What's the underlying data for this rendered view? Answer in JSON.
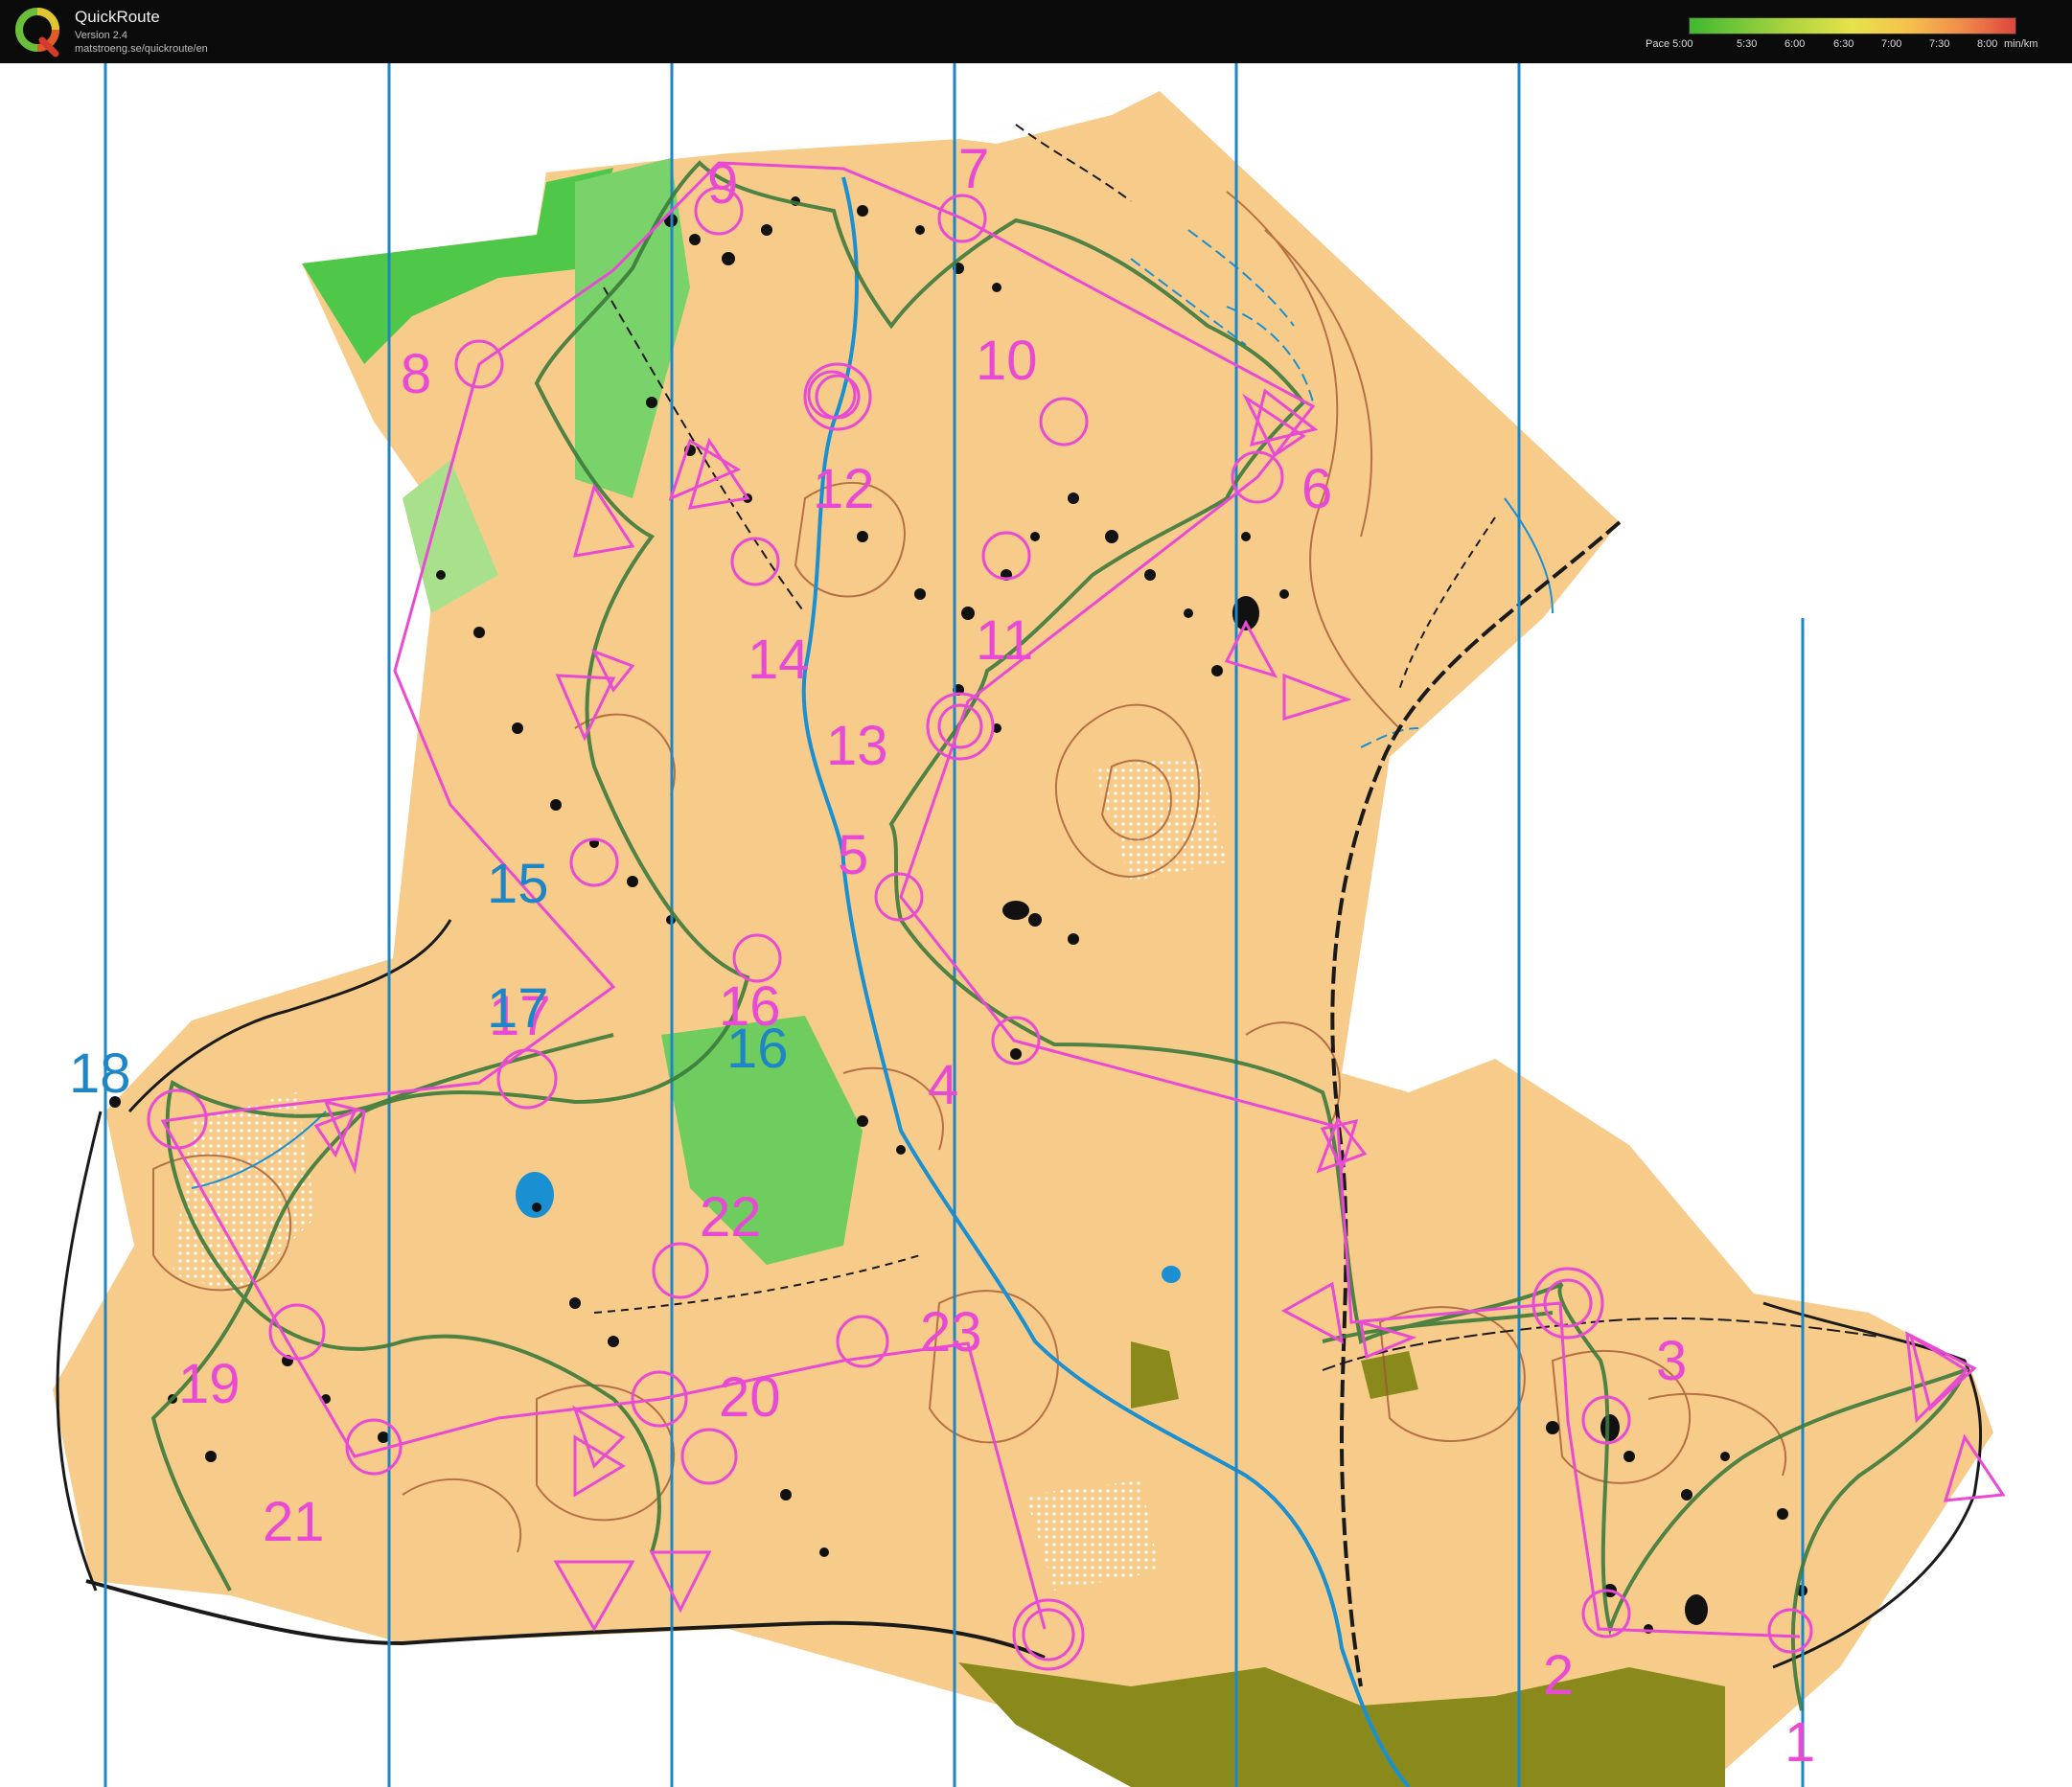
{
  "app": {
    "title": "QuickRoute",
    "version": "Version 2.4",
    "url": "matstroeng.se/quickroute/en"
  },
  "pace_legend": {
    "labels": [
      "Pace 5:00",
      "5:30",
      "6:00",
      "6:30",
      "7:00",
      "7:30",
      "8:00",
      "min/km"
    ],
    "colors": [
      "#3fb82f",
      "#7bc83a",
      "#b6d640",
      "#e7e24a",
      "#f5c24d",
      "#f08d4b",
      "#e0453d"
    ]
  },
  "map": {
    "colors": {
      "open_land": "#f7cc8a",
      "forest": "#ffffff",
      "green": "#4fc84a",
      "light_green": "#a9e08b",
      "contour": "#a0522d",
      "course": "#e84ad6",
      "route": "#3c7a3c",
      "water": "#1a8fd1",
      "split_line": "#1f86c6",
      "rock": "#111111",
      "settlement": "#8a8a1c"
    },
    "control_numbers": [
      "1",
      "2",
      "3",
      "4",
      "5",
      "6",
      "7",
      "8",
      "9",
      "10",
      "11",
      "12",
      "13",
      "14",
      "15",
      "16",
      "17",
      "18",
      "19",
      "20",
      "21",
      "22",
      "23"
    ],
    "lap_labels": [
      "15",
      "16",
      "17",
      "18"
    ]
  }
}
